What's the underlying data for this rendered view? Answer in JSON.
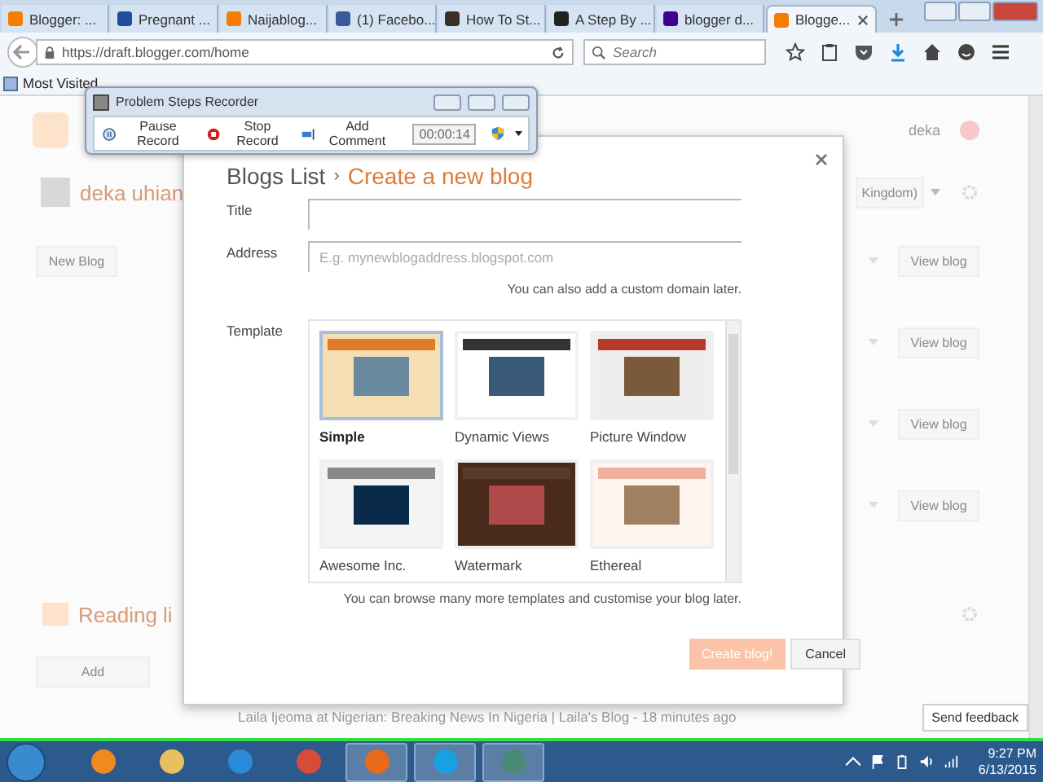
{
  "browser": {
    "tabs": [
      {
        "label": "Blogger: ...",
        "color": "#f57d00",
        "selected": false
      },
      {
        "label": "Pregnant ...",
        "color": "#1d4f9c",
        "selected": false
      },
      {
        "label": "Naijablog...",
        "color": "#f57d00",
        "selected": false
      },
      {
        "label": "(1) Facebo...",
        "color": "#3b5998",
        "selected": false
      },
      {
        "label": "How To St...",
        "color": "#3a3028",
        "selected": false
      },
      {
        "label": "A Step By ...",
        "color": "#222222",
        "selected": false
      },
      {
        "label": "blogger d...",
        "color": "#400191",
        "selected": false
      },
      {
        "label": "Blogge...",
        "color": "#f57d00",
        "selected": true
      }
    ],
    "url": "https://draft.blogger.com/home",
    "search": {
      "placeholder": "Search"
    },
    "bookmarks": [
      "Most Visited"
    ]
  },
  "page": {
    "user": "deka",
    "profile_name": "deka uhian",
    "region": "Kingdom)",
    "new_blog": "New Blog",
    "view_blog_buttons": [
      "View blog",
      "View blog",
      "View blog",
      "View blog"
    ],
    "reading_list": "Reading li",
    "add": "Add",
    "feed_item": "Laila Ijeoma at Nigerian: Breaking News In Nigeria | Laila's Blog - 18 minutes ago",
    "send_feedback": "Send feedback"
  },
  "recorder": {
    "title": "Problem Steps Recorder",
    "buttons": [
      {
        "kind": "pause",
        "label": "Pause Record"
      },
      {
        "kind": "stop",
        "label": "Stop Record"
      },
      {
        "kind": "comment",
        "label": "Add Comment"
      }
    ],
    "timer": "00:00:14"
  },
  "dialog": {
    "breadcrumb": "Blogs List",
    "separator": "›",
    "title": "Create a new blog",
    "fields": [
      {
        "label": "Title"
      },
      {
        "label": "Address",
        "placeholder": "E.g. mynewblogaddress.blogspot.com"
      }
    ],
    "address_hint": "You can also add a custom domain later.",
    "template_label": "Template",
    "templates": [
      {
        "name": "Simple",
        "selected": true
      },
      {
        "name": "Dynamic Views",
        "selected": false
      },
      {
        "name": "Picture Window",
        "selected": false
      },
      {
        "name": "Awesome Inc.",
        "selected": false
      },
      {
        "name": "Watermark",
        "selected": false
      },
      {
        "name": "Ethereal",
        "selected": false
      }
    ],
    "template_hint": "You can browse many more templates and customise your blog later.",
    "create_button": {
      "label": "Create blog!",
      "disabled": true
    },
    "cancel_button": "Cancel"
  },
  "taskbar": {
    "apps": [
      {
        "kind": "media",
        "active": false
      },
      {
        "kind": "folder",
        "active": false
      },
      {
        "kind": "ie",
        "active": false
      },
      {
        "kind": "chrome",
        "active": false
      },
      {
        "kind": "firefox",
        "active": true
      },
      {
        "kind": "skype",
        "active": true
      },
      {
        "kind": "recorder",
        "active": true
      }
    ],
    "time": "9:27 PM",
    "date": "6/13/2015"
  }
}
